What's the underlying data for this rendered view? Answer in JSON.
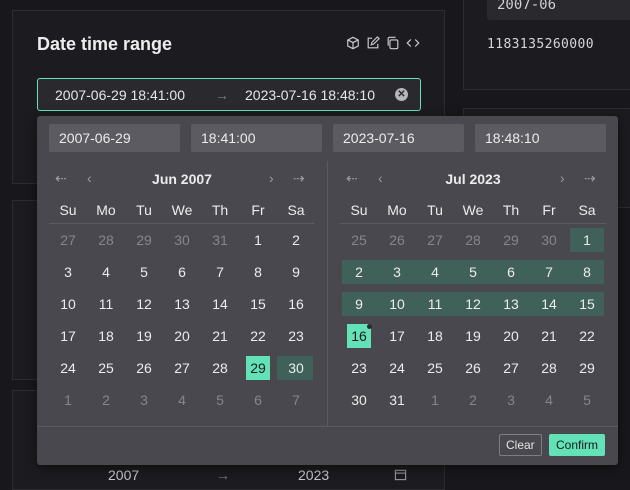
{
  "card": {
    "title": "Date time range"
  },
  "toolbar": {
    "icons": [
      "cube-icon",
      "edit-icon",
      "copy-icon",
      "code-icon"
    ]
  },
  "right": {
    "top_value": "2007-06",
    "code_value": "1183135260000"
  },
  "range": {
    "start": "2007-06-29 18:41:00",
    "arrow": "→",
    "end": "2023-07-16 18:48:10",
    "clear_glyph": "✕"
  },
  "bottom": {
    "start": "2007",
    "arrow": "→",
    "end": "2023"
  },
  "inputs": {
    "start_date": "2007-06-29",
    "start_time": "18:41:00",
    "end_date": "2023-07-16",
    "end_time": "18:48:10"
  },
  "nav": {
    "prev_year": "⇠",
    "prev_month": "‹",
    "next_month": "›",
    "next_year": "⇢"
  },
  "weekdays": [
    "Su",
    "Mo",
    "Tu",
    "We",
    "Th",
    "Fr",
    "Sa"
  ],
  "calendars": [
    {
      "title": "Jun 2007",
      "weeks": [
        [
          {
            "d": "27",
            "dim": 1
          },
          {
            "d": "28",
            "dim": 1
          },
          {
            "d": "29",
            "dim": 1
          },
          {
            "d": "30",
            "dim": 1
          },
          {
            "d": "31",
            "dim": 1
          },
          {
            "d": "1"
          },
          {
            "d": "2"
          }
        ],
        [
          {
            "d": "3"
          },
          {
            "d": "4"
          },
          {
            "d": "5"
          },
          {
            "d": "6"
          },
          {
            "d": "7"
          },
          {
            "d": "8"
          },
          {
            "d": "9"
          }
        ],
        [
          {
            "d": "10"
          },
          {
            "d": "11"
          },
          {
            "d": "12"
          },
          {
            "d": "13"
          },
          {
            "d": "14"
          },
          {
            "d": "15"
          },
          {
            "d": "16"
          }
        ],
        [
          {
            "d": "17"
          },
          {
            "d": "18"
          },
          {
            "d": "19"
          },
          {
            "d": "20"
          },
          {
            "d": "21"
          },
          {
            "d": "22"
          },
          {
            "d": "23"
          }
        ],
        [
          {
            "d": "24"
          },
          {
            "d": "25"
          },
          {
            "d": "26"
          },
          {
            "d": "27"
          },
          {
            "d": "28"
          },
          {
            "d": "29",
            "sel": 1
          },
          {
            "d": "30",
            "inr": 1,
            "re": 1
          }
        ],
        [
          {
            "d": "1",
            "dim": 1
          },
          {
            "d": "2",
            "dim": 1
          },
          {
            "d": "3",
            "dim": 1
          },
          {
            "d": "4",
            "dim": 1
          },
          {
            "d": "5",
            "dim": 1
          },
          {
            "d": "6",
            "dim": 1
          },
          {
            "d": "7",
            "dim": 1
          }
        ]
      ]
    },
    {
      "title": "Jul 2023",
      "weeks": [
        [
          {
            "d": "25",
            "dim": 1
          },
          {
            "d": "26",
            "dim": 1
          },
          {
            "d": "27",
            "dim": 1
          },
          {
            "d": "28",
            "dim": 1
          },
          {
            "d": "29",
            "dim": 1
          },
          {
            "d": "30",
            "dim": 1
          },
          {
            "d": "1",
            "inr": 1,
            "rs": 1,
            "re": 1
          }
        ],
        [
          {
            "d": "2",
            "inr": 1,
            "rs": 1
          },
          {
            "d": "3",
            "inr": 1
          },
          {
            "d": "4",
            "inr": 1
          },
          {
            "d": "5",
            "inr": 1
          },
          {
            "d": "6",
            "inr": 1
          },
          {
            "d": "7",
            "inr": 1
          },
          {
            "d": "8",
            "inr": 1,
            "re": 1
          }
        ],
        [
          {
            "d": "9",
            "inr": 1,
            "rs": 1
          },
          {
            "d": "10",
            "inr": 1
          },
          {
            "d": "11",
            "inr": 1
          },
          {
            "d": "12",
            "inr": 1
          },
          {
            "d": "13",
            "inr": 1
          },
          {
            "d": "14",
            "inr": 1
          },
          {
            "d": "15",
            "inr": 1,
            "re": 1
          }
        ],
        [
          {
            "d": "16",
            "sel": 1,
            "today": 1
          },
          {
            "d": "17"
          },
          {
            "d": "18"
          },
          {
            "d": "19"
          },
          {
            "d": "20"
          },
          {
            "d": "21"
          },
          {
            "d": "22"
          }
        ],
        [
          {
            "d": "23"
          },
          {
            "d": "24"
          },
          {
            "d": "25"
          },
          {
            "d": "26"
          },
          {
            "d": "27"
          },
          {
            "d": "28"
          },
          {
            "d": "29"
          }
        ],
        [
          {
            "d": "30"
          },
          {
            "d": "31"
          },
          {
            "d": "1",
            "dim": 1
          },
          {
            "d": "2",
            "dim": 1
          },
          {
            "d": "3",
            "dim": 1
          },
          {
            "d": "4",
            "dim": 1
          },
          {
            "d": "5",
            "dim": 1
          }
        ]
      ]
    }
  ],
  "actions": {
    "clear": "Clear",
    "confirm": "Confirm"
  },
  "colors": {
    "accent": "#63e2b7",
    "range_fill": "#40605a",
    "panel": "#48484e"
  }
}
